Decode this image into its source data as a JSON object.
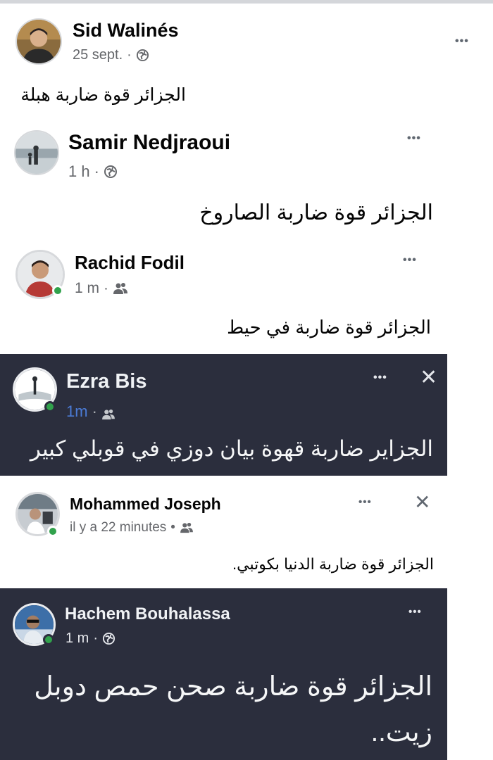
{
  "posts": [
    {
      "name": "Sid Walinés",
      "time": "25 sept.",
      "meta_sep": "·",
      "privacy_icon": "public-globe-icon",
      "more": "•••",
      "text": "الجزائر قوة ضاربة هبلة"
    },
    {
      "name": "Samir Nedjraoui",
      "time": "1 h",
      "meta_sep": "·",
      "privacy_icon": "public-globe-icon",
      "more": "•••",
      "text": "الجزائر قوة ضاربة الصاروخ"
    },
    {
      "name": "Rachid Fodil",
      "time": "1 m",
      "meta_sep": "·",
      "privacy_icon": "friends-icon",
      "more": "•••",
      "text": "الجزائر قوة ضاربة في حيط"
    },
    {
      "name": "Ezra Bis",
      "time": "1m",
      "meta_sep": "·",
      "privacy_icon": "friends-icon",
      "more": "•••",
      "close": "✕",
      "text": "الجزاير ضاربة قهوة بيان دوزي في قوبلي كبير"
    },
    {
      "name": "Mohammed Joseph",
      "time": "il y a 22 minutes",
      "meta_sep": "•",
      "privacy_icon": "friends-icon",
      "more": "•••",
      "close": "✕",
      "text": "الجزائر قوة ضاربة الدنيا بكوتبي."
    },
    {
      "name": "Hachem Bouhalassa",
      "time": "1 m",
      "meta_sep": "·",
      "privacy_icon": "public-globe-icon",
      "more": "•••",
      "text_line1": "الجزائر قوة ضاربة صحن حمص دوبل",
      "text_line2": "زيت.."
    }
  ],
  "colors": {
    "dark_panel": "#2b2e3d",
    "online": "#31a24c",
    "link_blue": "#4b7bd5"
  }
}
